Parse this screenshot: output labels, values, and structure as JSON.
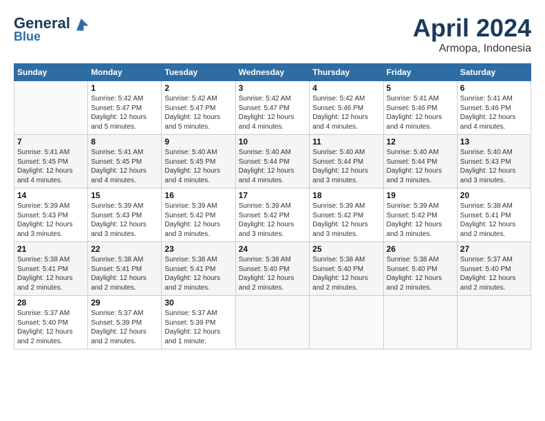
{
  "logo": {
    "line1": "General",
    "line2": "Blue"
  },
  "title": "April 2024",
  "subtitle": "Armopa, Indonesia",
  "days_header": [
    "Sunday",
    "Monday",
    "Tuesday",
    "Wednesday",
    "Thursday",
    "Friday",
    "Saturday"
  ],
  "weeks": [
    [
      {
        "num": "",
        "info": ""
      },
      {
        "num": "1",
        "info": "Sunrise: 5:42 AM\nSunset: 5:47 PM\nDaylight: 12 hours\nand 5 minutes."
      },
      {
        "num": "2",
        "info": "Sunrise: 5:42 AM\nSunset: 5:47 PM\nDaylight: 12 hours\nand 5 minutes."
      },
      {
        "num": "3",
        "info": "Sunrise: 5:42 AM\nSunset: 5:47 PM\nDaylight: 12 hours\nand 4 minutes."
      },
      {
        "num": "4",
        "info": "Sunrise: 5:42 AM\nSunset: 5:46 PM\nDaylight: 12 hours\nand 4 minutes."
      },
      {
        "num": "5",
        "info": "Sunrise: 5:41 AM\nSunset: 5:46 PM\nDaylight: 12 hours\nand 4 minutes."
      },
      {
        "num": "6",
        "info": "Sunrise: 5:41 AM\nSunset: 5:46 PM\nDaylight: 12 hours\nand 4 minutes."
      }
    ],
    [
      {
        "num": "7",
        "info": "Sunrise: 5:41 AM\nSunset: 5:45 PM\nDaylight: 12 hours\nand 4 minutes."
      },
      {
        "num": "8",
        "info": "Sunrise: 5:41 AM\nSunset: 5:45 PM\nDaylight: 12 hours\nand 4 minutes."
      },
      {
        "num": "9",
        "info": "Sunrise: 5:40 AM\nSunset: 5:45 PM\nDaylight: 12 hours\nand 4 minutes."
      },
      {
        "num": "10",
        "info": "Sunrise: 5:40 AM\nSunset: 5:44 PM\nDaylight: 12 hours\nand 4 minutes."
      },
      {
        "num": "11",
        "info": "Sunrise: 5:40 AM\nSunset: 5:44 PM\nDaylight: 12 hours\nand 3 minutes."
      },
      {
        "num": "12",
        "info": "Sunrise: 5:40 AM\nSunset: 5:44 PM\nDaylight: 12 hours\nand 3 minutes."
      },
      {
        "num": "13",
        "info": "Sunrise: 5:40 AM\nSunset: 5:43 PM\nDaylight: 12 hours\nand 3 minutes."
      }
    ],
    [
      {
        "num": "14",
        "info": "Sunrise: 5:39 AM\nSunset: 5:43 PM\nDaylight: 12 hours\nand 3 minutes."
      },
      {
        "num": "15",
        "info": "Sunrise: 5:39 AM\nSunset: 5:43 PM\nDaylight: 12 hours\nand 3 minutes."
      },
      {
        "num": "16",
        "info": "Sunrise: 5:39 AM\nSunset: 5:42 PM\nDaylight: 12 hours\nand 3 minutes."
      },
      {
        "num": "17",
        "info": "Sunrise: 5:39 AM\nSunset: 5:42 PM\nDaylight: 12 hours\nand 3 minutes."
      },
      {
        "num": "18",
        "info": "Sunrise: 5:39 AM\nSunset: 5:42 PM\nDaylight: 12 hours\nand 3 minutes."
      },
      {
        "num": "19",
        "info": "Sunrise: 5:39 AM\nSunset: 5:42 PM\nDaylight: 12 hours\nand 3 minutes."
      },
      {
        "num": "20",
        "info": "Sunrise: 5:38 AM\nSunset: 5:41 PM\nDaylight: 12 hours\nand 2 minutes."
      }
    ],
    [
      {
        "num": "21",
        "info": "Sunrise: 5:38 AM\nSunset: 5:41 PM\nDaylight: 12 hours\nand 2 minutes."
      },
      {
        "num": "22",
        "info": "Sunrise: 5:38 AM\nSunset: 5:41 PM\nDaylight: 12 hours\nand 2 minutes."
      },
      {
        "num": "23",
        "info": "Sunrise: 5:38 AM\nSunset: 5:41 PM\nDaylight: 12 hours\nand 2 minutes."
      },
      {
        "num": "24",
        "info": "Sunrise: 5:38 AM\nSunset: 5:40 PM\nDaylight: 12 hours\nand 2 minutes."
      },
      {
        "num": "25",
        "info": "Sunrise: 5:38 AM\nSunset: 5:40 PM\nDaylight: 12 hours\nand 2 minutes."
      },
      {
        "num": "26",
        "info": "Sunrise: 5:38 AM\nSunset: 5:40 PM\nDaylight: 12 hours\nand 2 minutes."
      },
      {
        "num": "27",
        "info": "Sunrise: 5:37 AM\nSunset: 5:40 PM\nDaylight: 12 hours\nand 2 minutes."
      }
    ],
    [
      {
        "num": "28",
        "info": "Sunrise: 5:37 AM\nSunset: 5:40 PM\nDaylight: 12 hours\nand 2 minutes."
      },
      {
        "num": "29",
        "info": "Sunrise: 5:37 AM\nSunset: 5:39 PM\nDaylight: 12 hours\nand 2 minutes."
      },
      {
        "num": "30",
        "info": "Sunrise: 5:37 AM\nSunset: 5:39 PM\nDaylight: 12 hours\nand 1 minute."
      },
      {
        "num": "",
        "info": ""
      },
      {
        "num": "",
        "info": ""
      },
      {
        "num": "",
        "info": ""
      },
      {
        "num": "",
        "info": ""
      }
    ]
  ]
}
